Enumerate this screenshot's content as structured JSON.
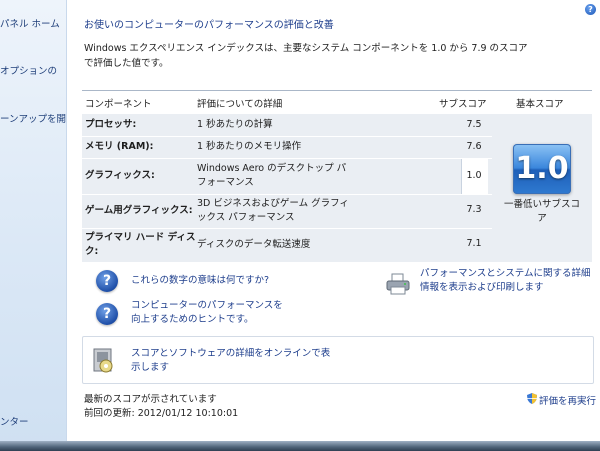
{
  "sidebar": {
    "links": [
      "パネル ホーム",
      "オプションの",
      "ーンアップを開",
      "ンター"
    ]
  },
  "header": {
    "title": "お使いのコンピューターのパフォーマンスの評価と改善",
    "description": "Windows エクスペリエンス インデックスは、主要なシステム コンポーネントを 1.0 から 7.9 のスコアで評価した値です。",
    "help_glyph": "?"
  },
  "table": {
    "headers": {
      "component": "コンポーネント",
      "detail": "評価についての詳細",
      "subscore": "サブスコア",
      "basescore": "基本スコア"
    },
    "rows": [
      {
        "name": "プロセッサ:",
        "detail": "1 秒あたりの計算",
        "score": "7.5"
      },
      {
        "name": "メモリ (RAM):",
        "detail": "1 秒あたりのメモリ操作",
        "score": "7.6"
      },
      {
        "name": "グラフィックス:",
        "detail": "Windows Aero のデスクトップ パフォーマンス",
        "score": "1.0"
      },
      {
        "name": "ゲーム用グラフィックス:",
        "detail": "3D ビジネスおよびゲーム グラフィックス パフォーマンス",
        "score": "7.3"
      },
      {
        "name": "プライマリ ハード ディスク:",
        "detail": "ディスクのデータ転送速度",
        "score": "7.1"
      }
    ],
    "base_score": "1.0",
    "base_caption": "一番低いサブスコア"
  },
  "links": {
    "numbers_meaning": "これらの数字の意味は何ですか?",
    "improve_tips": "コンピューターのパフォーマンスを向上するためのヒントです。",
    "print_details": "パフォーマンスとシステムに関する詳細情報を表示および印刷します",
    "online_details": "スコアとソフトウェアの詳細をオンラインで表示します",
    "rerun": "評価を再実行",
    "question_glyph": "?"
  },
  "status": {
    "current": "最新のスコアが示されています",
    "last_update": "前回の更新: 2012/01/12 10:10:01"
  },
  "colors": {
    "link": "#1e3e8c",
    "row_bg": "#eaeef3",
    "badge": "#2f7ad0"
  }
}
